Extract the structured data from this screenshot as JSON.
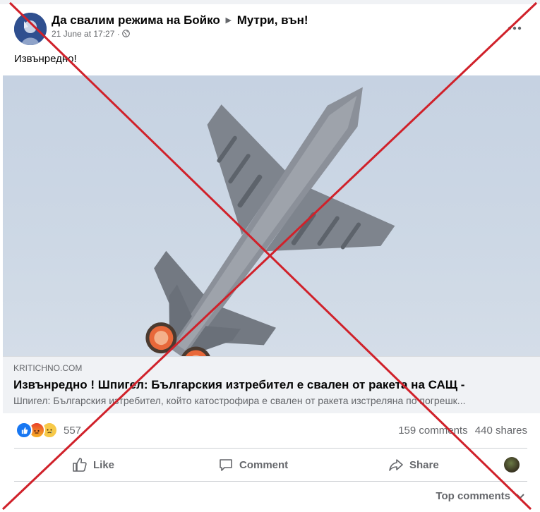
{
  "post": {
    "group_name": "Да свалим режима на Бойко",
    "group_separator": "▶",
    "group_name_suffix": "Мутри, вън!",
    "timestamp": "21 June at 17:27",
    "meta_separator": "·",
    "audience_icon": "globe-icon",
    "more_icon": "more-options-icon",
    "text": "Извънредно!"
  },
  "link_preview": {
    "domain": "KRITICHNO.COM",
    "title": "Извънредно ! Шпигел: Българския изтребител е свален от ракета на САЩ -",
    "description": "Шпигел: Българския изтребител, който катострофира е свален от ракета изстреляна по погрешк..."
  },
  "reactions": {
    "icons": [
      "like-reaction-icon",
      "angry-reaction-icon",
      "sad-reaction-icon"
    ],
    "count": "557",
    "comments": "159 comments",
    "shares": "440 shares"
  },
  "actions": {
    "like": "Like",
    "comment": "Comment",
    "share": "Share"
  },
  "comments": {
    "sort_label": "Top comments"
  },
  "colors": {
    "cross": "#d0212a",
    "like_blue": "#1877f2",
    "muted_text": "#65676b",
    "link_bg": "#f0f2f5"
  }
}
